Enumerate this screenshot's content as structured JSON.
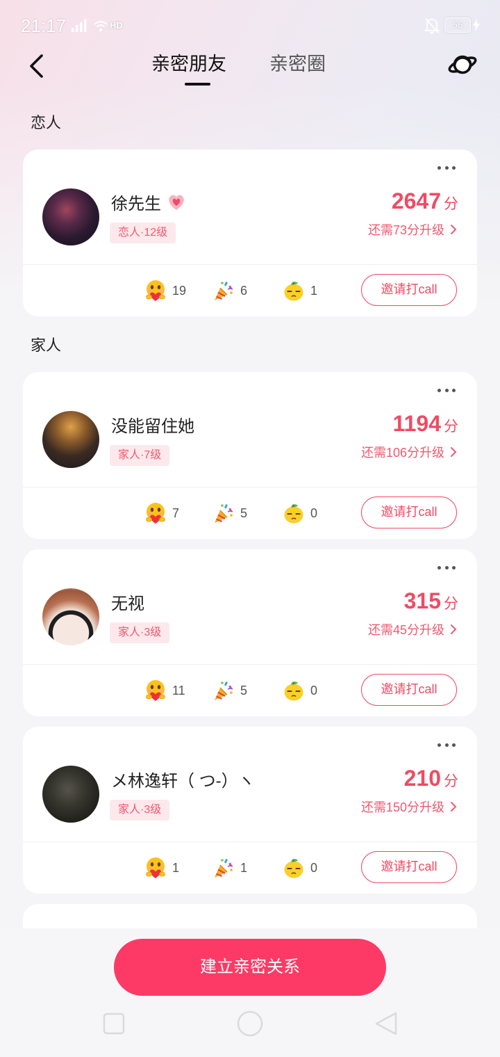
{
  "status_bar": {
    "time": "21:17",
    "network_badge": "HD",
    "battery": "56"
  },
  "header": {
    "tabs": [
      {
        "label": "亲密朋友",
        "active": true
      },
      {
        "label": "亲密圈",
        "active": false
      }
    ]
  },
  "score_unit": "分",
  "invite_label": "邀请打call",
  "sections": [
    {
      "title": "恋人",
      "cards": [
        {
          "name": "徐先生",
          "badge": "heart-badge-icon",
          "tag": "恋人·12级",
          "score": 2647,
          "upgrade": "还需73分升级",
          "reactions": [
            {
              "icon": "hug-emoji-icon",
              "count": 19
            },
            {
              "icon": "party-popper-icon",
              "count": 6
            },
            {
              "icon": "lemon-face-icon",
              "count": 1
            }
          ]
        }
      ]
    },
    {
      "title": "家人",
      "cards": [
        {
          "name": "没能留住她",
          "tag": "家人·7级",
          "score": 1194,
          "upgrade": "还需106分升级",
          "reactions": [
            {
              "icon": "hug-emoji-icon",
              "count": 7
            },
            {
              "icon": "party-popper-icon",
              "count": 5
            },
            {
              "icon": "lemon-face-icon",
              "count": 0
            }
          ]
        },
        {
          "name": "无视",
          "tag": "家人·3级",
          "score": 315,
          "upgrade": "还需45分升级",
          "reactions": [
            {
              "icon": "hug-emoji-icon",
              "count": 11
            },
            {
              "icon": "party-popper-icon",
              "count": 5
            },
            {
              "icon": "lemon-face-icon",
              "count": 0
            }
          ]
        },
        {
          "name": "メ林逸轩（ つ-）ヽ",
          "tag": "家人·3级",
          "score": 210,
          "upgrade": "还需150分升级",
          "reactions": [
            {
              "icon": "hug-emoji-icon",
              "count": 1
            },
            {
              "icon": "party-popper-icon",
              "count": 1
            },
            {
              "icon": "lemon-face-icon",
              "count": 0
            }
          ]
        }
      ]
    }
  ],
  "footer": {
    "create_button": "建立亲密关系"
  },
  "colors": {
    "accent": "#fd3a65",
    "score": "#ef4b64",
    "tag_bg": "#fde8ec",
    "tag_text": "#ef5a70"
  }
}
